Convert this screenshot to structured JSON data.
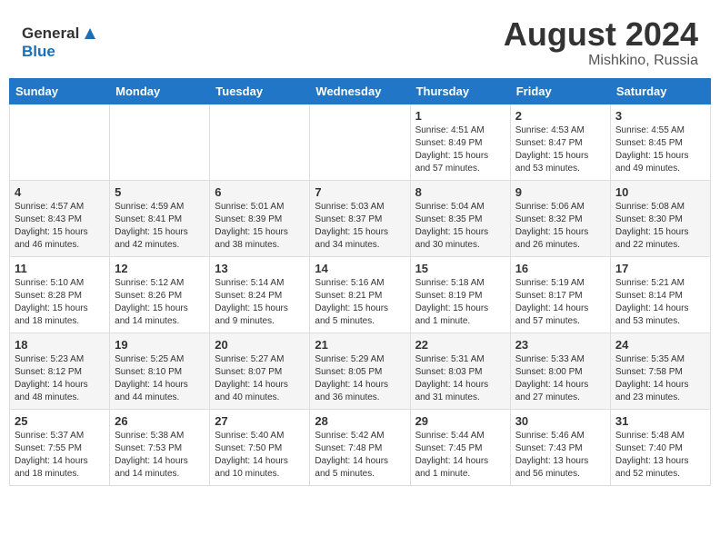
{
  "header": {
    "logo_line1": "General",
    "logo_line2": "Blue",
    "month_year": "August 2024",
    "location": "Mishkino, Russia"
  },
  "weekdays": [
    "Sunday",
    "Monday",
    "Tuesday",
    "Wednesday",
    "Thursday",
    "Friday",
    "Saturday"
  ],
  "weeks": [
    [
      {
        "day": "",
        "info": ""
      },
      {
        "day": "",
        "info": ""
      },
      {
        "day": "",
        "info": ""
      },
      {
        "day": "",
        "info": ""
      },
      {
        "day": "1",
        "info": "Sunrise: 4:51 AM\nSunset: 8:49 PM\nDaylight: 15 hours\nand 57 minutes."
      },
      {
        "day": "2",
        "info": "Sunrise: 4:53 AM\nSunset: 8:47 PM\nDaylight: 15 hours\nand 53 minutes."
      },
      {
        "day": "3",
        "info": "Sunrise: 4:55 AM\nSunset: 8:45 PM\nDaylight: 15 hours\nand 49 minutes."
      }
    ],
    [
      {
        "day": "4",
        "info": "Sunrise: 4:57 AM\nSunset: 8:43 PM\nDaylight: 15 hours\nand 46 minutes."
      },
      {
        "day": "5",
        "info": "Sunrise: 4:59 AM\nSunset: 8:41 PM\nDaylight: 15 hours\nand 42 minutes."
      },
      {
        "day": "6",
        "info": "Sunrise: 5:01 AM\nSunset: 8:39 PM\nDaylight: 15 hours\nand 38 minutes."
      },
      {
        "day": "7",
        "info": "Sunrise: 5:03 AM\nSunset: 8:37 PM\nDaylight: 15 hours\nand 34 minutes."
      },
      {
        "day": "8",
        "info": "Sunrise: 5:04 AM\nSunset: 8:35 PM\nDaylight: 15 hours\nand 30 minutes."
      },
      {
        "day": "9",
        "info": "Sunrise: 5:06 AM\nSunset: 8:32 PM\nDaylight: 15 hours\nand 26 minutes."
      },
      {
        "day": "10",
        "info": "Sunrise: 5:08 AM\nSunset: 8:30 PM\nDaylight: 15 hours\nand 22 minutes."
      }
    ],
    [
      {
        "day": "11",
        "info": "Sunrise: 5:10 AM\nSunset: 8:28 PM\nDaylight: 15 hours\nand 18 minutes."
      },
      {
        "day": "12",
        "info": "Sunrise: 5:12 AM\nSunset: 8:26 PM\nDaylight: 15 hours\nand 14 minutes."
      },
      {
        "day": "13",
        "info": "Sunrise: 5:14 AM\nSunset: 8:24 PM\nDaylight: 15 hours\nand 9 minutes."
      },
      {
        "day": "14",
        "info": "Sunrise: 5:16 AM\nSunset: 8:21 PM\nDaylight: 15 hours\nand 5 minutes."
      },
      {
        "day": "15",
        "info": "Sunrise: 5:18 AM\nSunset: 8:19 PM\nDaylight: 15 hours\nand 1 minute."
      },
      {
        "day": "16",
        "info": "Sunrise: 5:19 AM\nSunset: 8:17 PM\nDaylight: 14 hours\nand 57 minutes."
      },
      {
        "day": "17",
        "info": "Sunrise: 5:21 AM\nSunset: 8:14 PM\nDaylight: 14 hours\nand 53 minutes."
      }
    ],
    [
      {
        "day": "18",
        "info": "Sunrise: 5:23 AM\nSunset: 8:12 PM\nDaylight: 14 hours\nand 48 minutes."
      },
      {
        "day": "19",
        "info": "Sunrise: 5:25 AM\nSunset: 8:10 PM\nDaylight: 14 hours\nand 44 minutes."
      },
      {
        "day": "20",
        "info": "Sunrise: 5:27 AM\nSunset: 8:07 PM\nDaylight: 14 hours\nand 40 minutes."
      },
      {
        "day": "21",
        "info": "Sunrise: 5:29 AM\nSunset: 8:05 PM\nDaylight: 14 hours\nand 36 minutes."
      },
      {
        "day": "22",
        "info": "Sunrise: 5:31 AM\nSunset: 8:03 PM\nDaylight: 14 hours\nand 31 minutes."
      },
      {
        "day": "23",
        "info": "Sunrise: 5:33 AM\nSunset: 8:00 PM\nDaylight: 14 hours\nand 27 minutes."
      },
      {
        "day": "24",
        "info": "Sunrise: 5:35 AM\nSunset: 7:58 PM\nDaylight: 14 hours\nand 23 minutes."
      }
    ],
    [
      {
        "day": "25",
        "info": "Sunrise: 5:37 AM\nSunset: 7:55 PM\nDaylight: 14 hours\nand 18 minutes."
      },
      {
        "day": "26",
        "info": "Sunrise: 5:38 AM\nSunset: 7:53 PM\nDaylight: 14 hours\nand 14 minutes."
      },
      {
        "day": "27",
        "info": "Sunrise: 5:40 AM\nSunset: 7:50 PM\nDaylight: 14 hours\nand 10 minutes."
      },
      {
        "day": "28",
        "info": "Sunrise: 5:42 AM\nSunset: 7:48 PM\nDaylight: 14 hours\nand 5 minutes."
      },
      {
        "day": "29",
        "info": "Sunrise: 5:44 AM\nSunset: 7:45 PM\nDaylight: 14 hours\nand 1 minute."
      },
      {
        "day": "30",
        "info": "Sunrise: 5:46 AM\nSunset: 7:43 PM\nDaylight: 13 hours\nand 56 minutes."
      },
      {
        "day": "31",
        "info": "Sunrise: 5:48 AM\nSunset: 7:40 PM\nDaylight: 13 hours\nand 52 minutes."
      }
    ]
  ]
}
